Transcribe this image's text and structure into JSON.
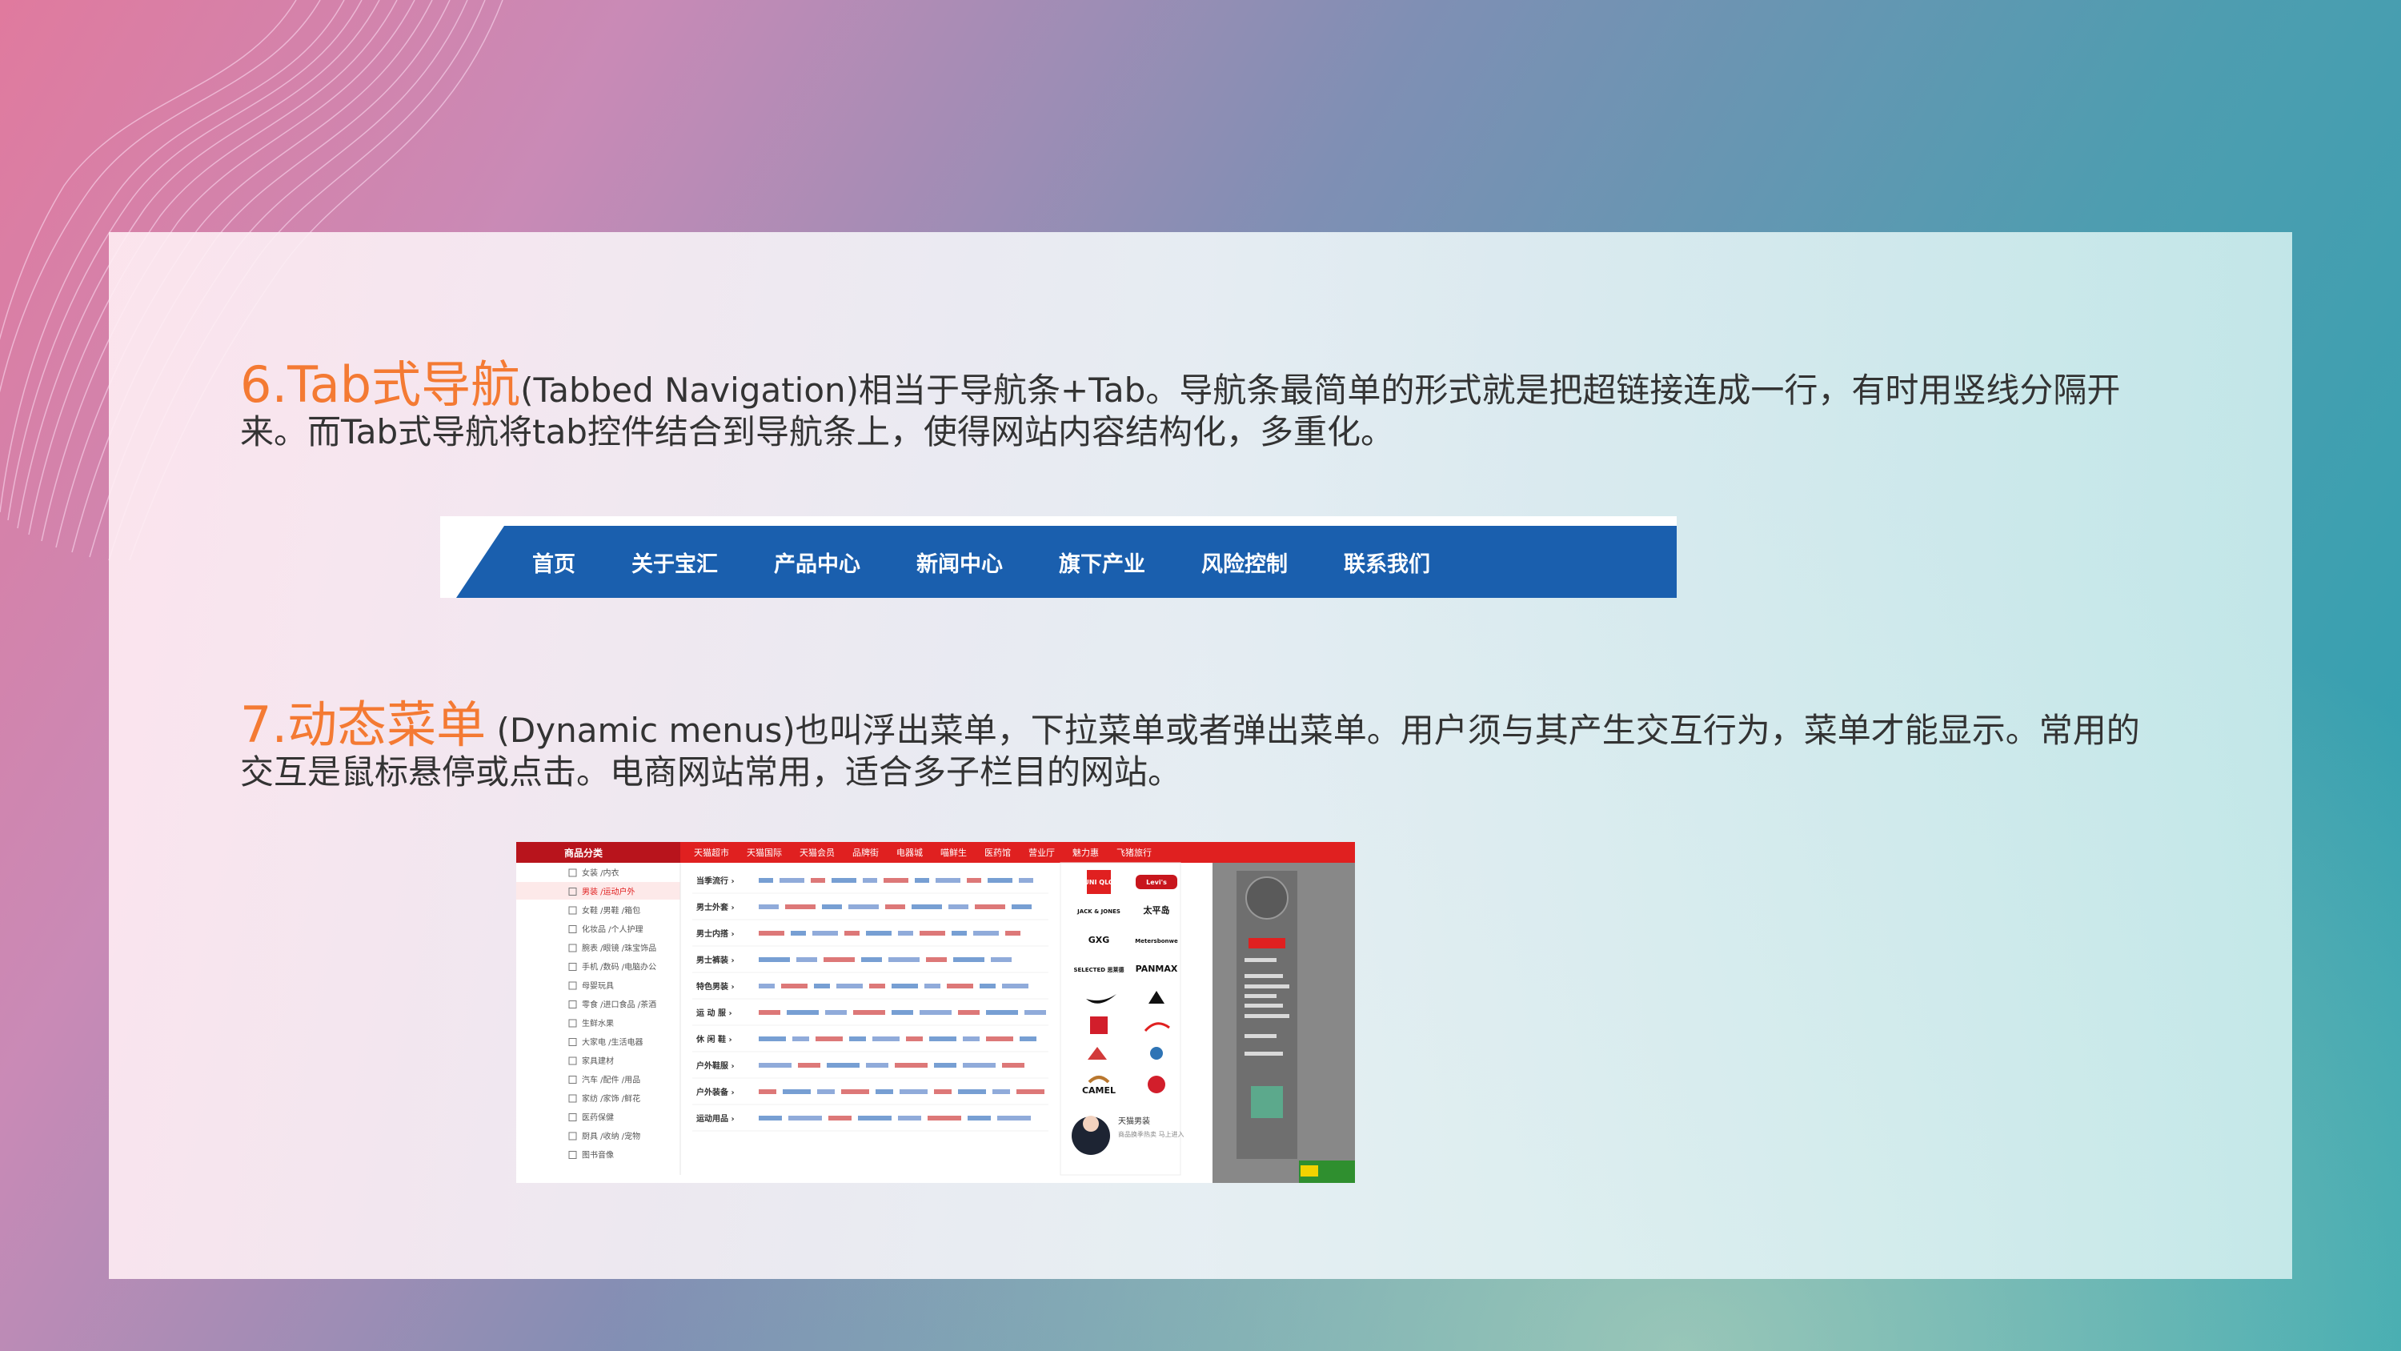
{
  "slide": {
    "section6": {
      "heading": "6.Tab式导航",
      "body": "(Tabbed Navigation)相当于导航条+Tab。导航条最简单的形式就是把超链接连成一行，有时用竖线分隔开来。而Tab式导航将tab控件结合到导航条上，使得网站内容结构化，多重化。"
    },
    "tab_nav_example": {
      "items": [
        "首页",
        "关于宝汇",
        "产品中心",
        "新闻中心",
        "旗下产业",
        "风险控制",
        "联系我们"
      ],
      "bar_color": "#1a5fae"
    },
    "section7": {
      "heading": "7.动态菜单",
      "body": " (Dynamic menus)也叫浮出菜单，下拉菜单或者弹出菜单。用户须与其产生交互行为，菜单才能显示。常用的交互是鼠标悬停或点击。电商网站常用，适合多子栏目的网站。"
    },
    "dynamic_menu_example": {
      "sidebar_title": "商品分类",
      "top_nav": [
        "天猫超市",
        "天猫国际",
        "天猫会员",
        "品牌街",
        "电器城",
        "喵鲜生",
        "医药馆",
        "营业厅",
        "魅力惠",
        "飞猪旅行"
      ],
      "sidebar_items": [
        "女装 /内衣",
        "男装 /运动户外",
        "女鞋 /男鞋 /箱包",
        "化妆品 /个人护理",
        "腕表 /眼镜 /珠宝饰品",
        "手机 /数码 /电脑办公",
        "母婴玩具",
        "零食 /进口食品 /茶酒",
        "生鲜水果",
        "大家电 /生活电器",
        "家具建材",
        "汽车 /配件 /用品",
        "家纺 /家饰 /鲜花",
        "医药保健",
        "厨具 /收纳 /宠物",
        "图书音像"
      ],
      "category_rows": [
        "当季流行 ›",
        "男士外套 ›",
        "男士内搭 ›",
        "男士裤装 ›",
        "特色男装 ›",
        "运 动 服 ›",
        "休 闲 鞋 ›",
        "户外鞋服 ›",
        "户外装备 ›",
        "运动用品 ›"
      ],
      "brands": [
        "UNI QLO",
        "Levi's",
        "JACK & JONES",
        "太平岛",
        "GXG",
        "Metersbonwe",
        "SELECTED 思莱德",
        "PANMAX",
        "CAMEL"
      ],
      "promo_title": "天猫男装",
      "promo_sub": "商品换季热卖 马上进入",
      "accent_color": "#e02020"
    }
  }
}
